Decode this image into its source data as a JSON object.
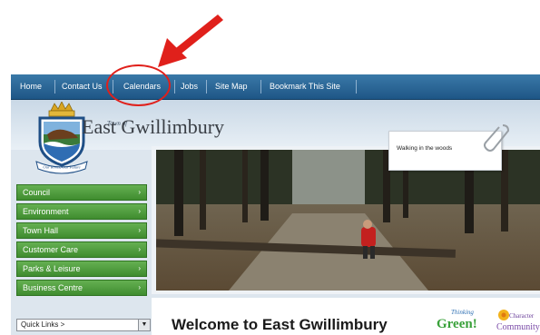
{
  "topnav": {
    "items": [
      "Home",
      "Contact Us",
      "Calendars",
      "Jobs",
      "Site Map",
      "Bookmark This Site"
    ]
  },
  "header": {
    "town_of": "Town of",
    "town_name": "East Gwillimbury",
    "crest_banner": "Our Roots, Our Future"
  },
  "leftnav": {
    "items": [
      "Council",
      "Environment",
      "Town Hall",
      "Customer Care",
      "Parks & Leisure",
      "Business Centre"
    ],
    "chevron": "›"
  },
  "quick_links": {
    "label": "Quick Links >",
    "dropdown_icon": "▼"
  },
  "photo": {
    "caption": "Walking in the woods"
  },
  "welcome": {
    "title": "Welcome to East Gwillimbury"
  },
  "logos": {
    "thinking_green_top": "Thinking",
    "thinking_green_main": "Green!",
    "character_top": "Character",
    "character_main": "Community"
  },
  "colors": {
    "nav_blue": "#1e5686",
    "nav_green": "#4a9a3a",
    "highlight_red": "#e0201b"
  }
}
